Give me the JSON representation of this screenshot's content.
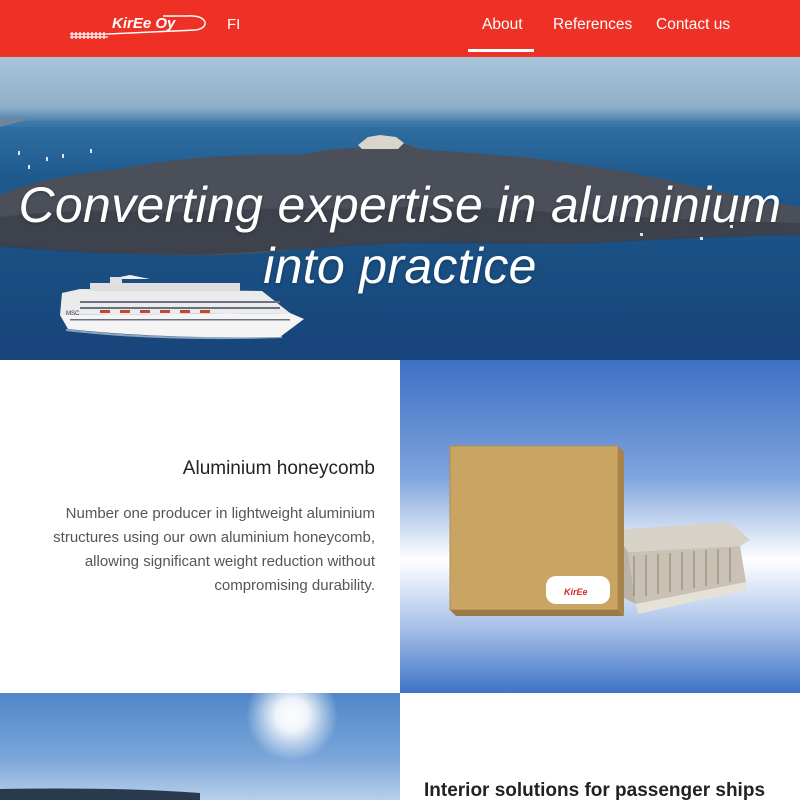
{
  "header": {
    "logo_text": "KirEe Oy",
    "language": "FI",
    "nav": [
      {
        "label": "About",
        "active": true
      },
      {
        "label": "References",
        "active": false
      },
      {
        "label": "Contact us",
        "active": false
      }
    ],
    "background_color": "#ee3124"
  },
  "hero": {
    "title": "Converting expertise in aluminium into practice",
    "ship_logo_text": "MSC"
  },
  "sections": [
    {
      "heading": "Aluminium honeycomb",
      "body": "Number one producer in lightweight aluminium structures using our own aluminium honeycomb, allowing significant weight reduction without compromising durability.",
      "panel_logo_text": "KirEe"
    },
    {
      "heading": "Interior solutions for passenger ships"
    }
  ]
}
